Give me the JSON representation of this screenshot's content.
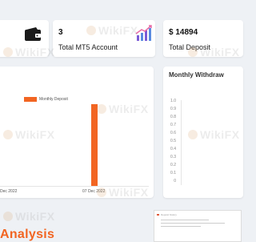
{
  "stats": [
    {
      "value": "",
      "label": "",
      "icon": "wallet-icon"
    },
    {
      "value": "3",
      "label": "Total MT5 Account",
      "icon": "growth-chart-icon"
    },
    {
      "value": "$ 14894",
      "label": "Total Deposit"
    }
  ],
  "deposit_chart": {
    "legend": "Monthly Deposit",
    "color": "#f26522",
    "x_labels": [
      "Dec 2022",
      "07 Dec 2022"
    ]
  },
  "withdraw_chart": {
    "title": "Monthly Withdraw",
    "y_ticks": [
      "1.0",
      "0.9",
      "0.8",
      "0.7",
      "0.6",
      "0.5",
      "0.4",
      "0.3",
      "0.2",
      "0.1",
      "0"
    ]
  },
  "chart_data": [
    {
      "type": "bar",
      "title": "",
      "series": [
        {
          "name": "Monthly Deposit",
          "values": [
            14894
          ]
        }
      ],
      "categories": [
        "07 Dec 2022"
      ],
      "x_labels": [
        "Dec 2022",
        "07 Dec 2022"
      ],
      "color": "#f26522"
    },
    {
      "type": "bar",
      "title": "Monthly Withdraw",
      "series": [],
      "ylim": [
        0,
        1.0
      ]
    }
  ],
  "watermark": "WikiFX",
  "section_heading": "Analysis",
  "thumbnail": {
    "header": "Deposit history"
  }
}
